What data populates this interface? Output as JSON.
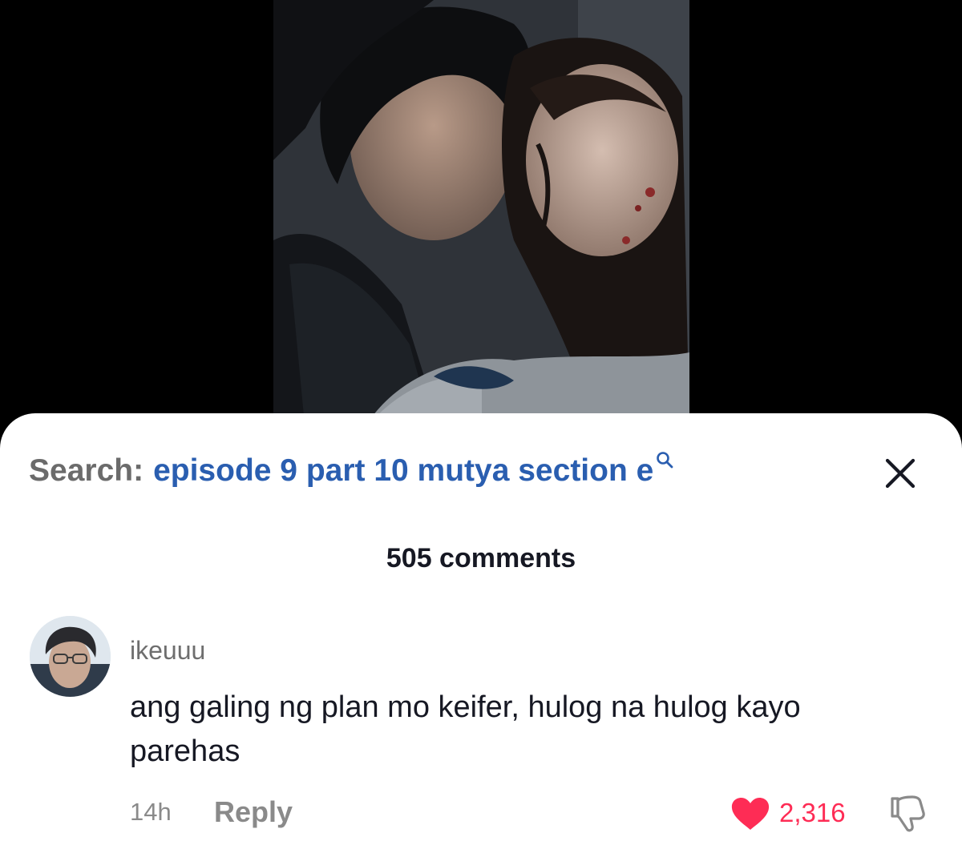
{
  "search": {
    "prefix": "Search:",
    "query": "episode 9 part 10 mutya section e",
    "icon": "search-icon"
  },
  "sheet": {
    "close_icon": "close-icon",
    "comment_count": "505 comments"
  },
  "comment": {
    "username": "ikeuuu",
    "text": "ang galing ng plan mo keifer, hulog na hulog kayo parehas",
    "time": "14h",
    "reply_label": "Reply",
    "likes": "2,316",
    "like_icon": "heart-icon",
    "dislike_icon": "thumbs-down-icon"
  },
  "colors": {
    "query_link": "#2a5eb0",
    "like_red": "#fe2c55",
    "muted_gray": "#8a8a8a"
  }
}
